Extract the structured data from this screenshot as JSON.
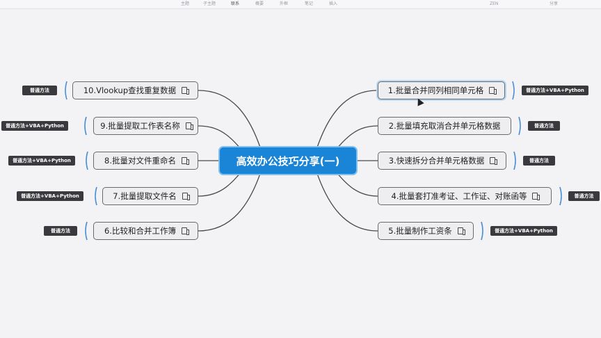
{
  "toolbar": {
    "items": [
      "主题",
      "子主题",
      "联系",
      "概要",
      "外框",
      "笔记",
      "插入"
    ],
    "zen": "ZEN",
    "share": "分享"
  },
  "map": {
    "center": "高效办公技巧分享(一)",
    "right": [
      {
        "label": "1.批量合并同列相同单元格",
        "tag": "普通方法+VBA+Python"
      },
      {
        "label": "2.批量填充取消合并单元格数据",
        "tag": "普通方法"
      },
      {
        "label": "3.快速拆分合并单元格数据",
        "tag": "普通方法"
      },
      {
        "label": "4.批量套打准考证、工作证、对账函等",
        "tag": "普通方法"
      },
      {
        "label": "5.批量制作工资条",
        "tag": "普通方法+VBA+Python"
      }
    ],
    "left": [
      {
        "label": "10.Vlookup查找重复数据",
        "tag": "普通方法"
      },
      {
        "label": "9.批量提取工作表名称",
        "tag": "普通方法+VBA+Python"
      },
      {
        "label": "8.批量对文件重命名",
        "tag": "普通方法+VBA+Python"
      },
      {
        "label": "7.批量提取文件名",
        "tag": "普通方法+VBA+Python"
      },
      {
        "label": "6.比较和合并工作簿",
        "tag": "普通方法"
      }
    ]
  },
  "colors": {
    "center": "#1a84d6",
    "tag": "#3a3a3e",
    "line": "#4a4a4e",
    "bracket": "#4a8fd6"
  }
}
